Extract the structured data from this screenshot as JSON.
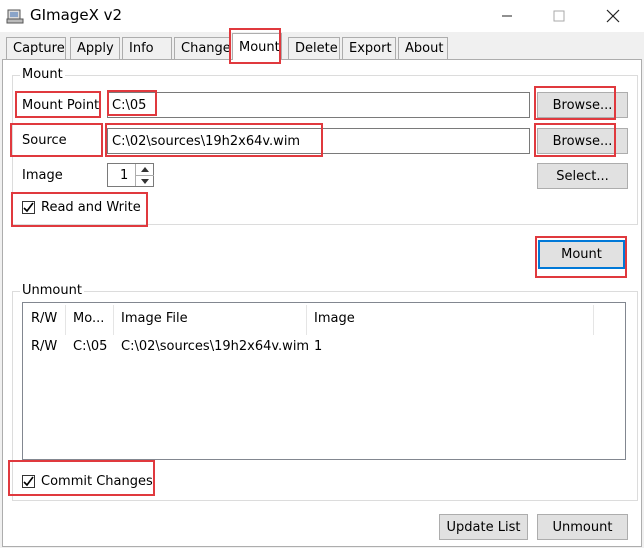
{
  "window": {
    "title": "GImageX v2",
    "minimize_icon": "minimize-icon",
    "maximize_icon": "maximize-icon",
    "close_icon": "close-icon"
  },
  "tabs": [
    "Capture",
    "Apply",
    "Info",
    "Change",
    "Mount",
    "Delete",
    "Export",
    "About"
  ],
  "active_tab": "Mount",
  "mount": {
    "group_title": "Mount",
    "mount_point_label": "Mount Point",
    "mount_point_value": "C:\\05",
    "source_label": "Source",
    "source_value": "C:\\02\\sources\\19h2x64v.wim",
    "image_label": "Image",
    "image_value": "1",
    "browse_label": "Browse...",
    "select_label": "Select...",
    "read_write_label": "Read and Write",
    "read_write_checked": true,
    "mount_button_label": "Mount"
  },
  "unmount": {
    "group_title": "Unmount",
    "columns": [
      "R/W",
      "Mo...",
      "Image File",
      "Image"
    ],
    "rows": [
      [
        "R/W",
        "C:\\05",
        "C:\\02\\sources\\19h2x64v.wim",
        "1"
      ]
    ],
    "commit_label": "Commit Changes",
    "commit_checked": true,
    "update_list_label": "Update List",
    "unmount_label": "Unmount"
  },
  "colors": {
    "highlight": "#e0393e",
    "focus": "#0078d7"
  }
}
